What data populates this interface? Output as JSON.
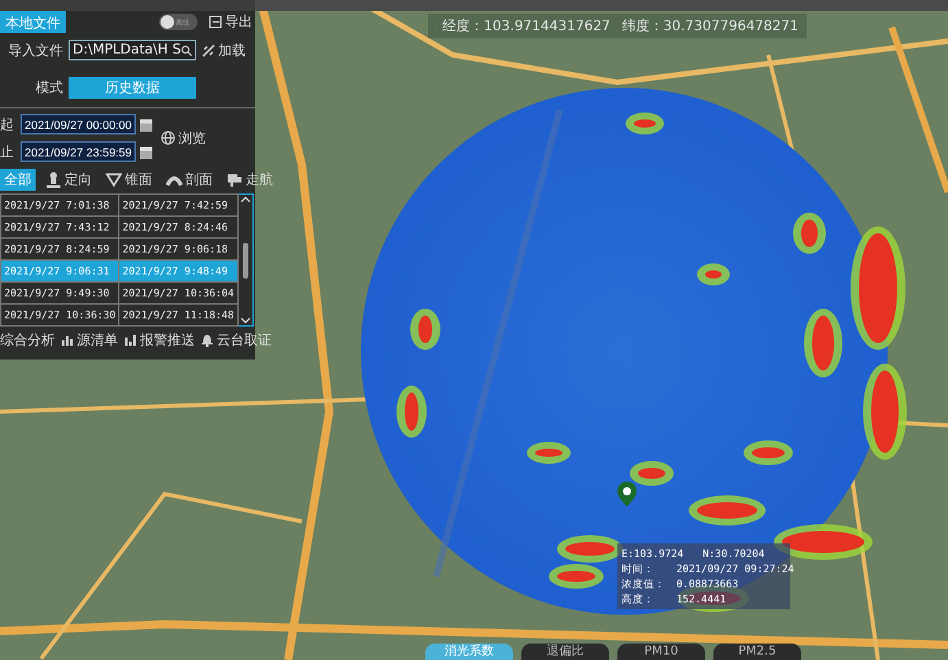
{
  "panel": {
    "tab": {
      "label": "本地文件",
      "selected": true
    },
    "offline_toggle": {
      "label": "离线",
      "on": false
    },
    "export_button": "导出",
    "import": {
      "label": "导入文件",
      "value": "D:\\MPLData\\H S",
      "load_button": "加载"
    },
    "mode": {
      "label": "模式",
      "value": "历史数据"
    },
    "start": {
      "label": "起",
      "value": "2021/09/27 00:00:00"
    },
    "end": {
      "label": "止",
      "value": "2021/09/27 23:59:59"
    },
    "browse_button": "浏览",
    "scan_tabs": [
      {
        "label": "全部",
        "selected": true
      },
      {
        "label": "定向",
        "selected": false
      },
      {
        "label": "锥面",
        "selected": false
      },
      {
        "label": "剖面",
        "selected": false
      },
      {
        "label": "走航",
        "selected": false
      }
    ],
    "records": [
      {
        "start": "2021/9/27 7:01:38",
        "end": "2021/9/27 7:42:59",
        "selected": false
      },
      {
        "start": "2021/9/27 7:43:12",
        "end": "2021/9/27 8:24:46",
        "selected": false
      },
      {
        "start": "2021/9/27 8:24:59",
        "end": "2021/9/27 9:06:18",
        "selected": false
      },
      {
        "start": "2021/9/27 9:06:31",
        "end": "2021/9/27 9:48:49",
        "selected": true
      },
      {
        "start": "2021/9/27 9:49:30",
        "end": "2021/9/27 10:36:04",
        "selected": false
      },
      {
        "start": "2021/9/27 10:36:30",
        "end": "2021/9/27 11:18:48",
        "selected": false
      }
    ],
    "actions": [
      "综合分析",
      "源清单",
      "报警推送",
      "云台取证"
    ]
  },
  "coordinates": {
    "longitude_label": "经度：",
    "longitude": "103.97144317627",
    "latitude_label": "纬度：",
    "latitude": "30.7307796478271"
  },
  "tooltip": {
    "position": [
      "E:103.9724",
      "N:30.70204"
    ],
    "rows": [
      {
        "label": "时间：",
        "value": "2021/09/27 09:27:24"
      },
      {
        "label": "浓度值：",
        "value": "0.08873663"
      },
      {
        "label": "高度：",
        "value": "152.4441"
      }
    ]
  },
  "layer_tabs": [
    {
      "label": "消光系数",
      "selected": true
    },
    {
      "label": "退偏比",
      "selected": false
    },
    {
      "label": "PM10",
      "selected": false
    },
    {
      "label": "PM2.5",
      "selected": false
    }
  ]
}
